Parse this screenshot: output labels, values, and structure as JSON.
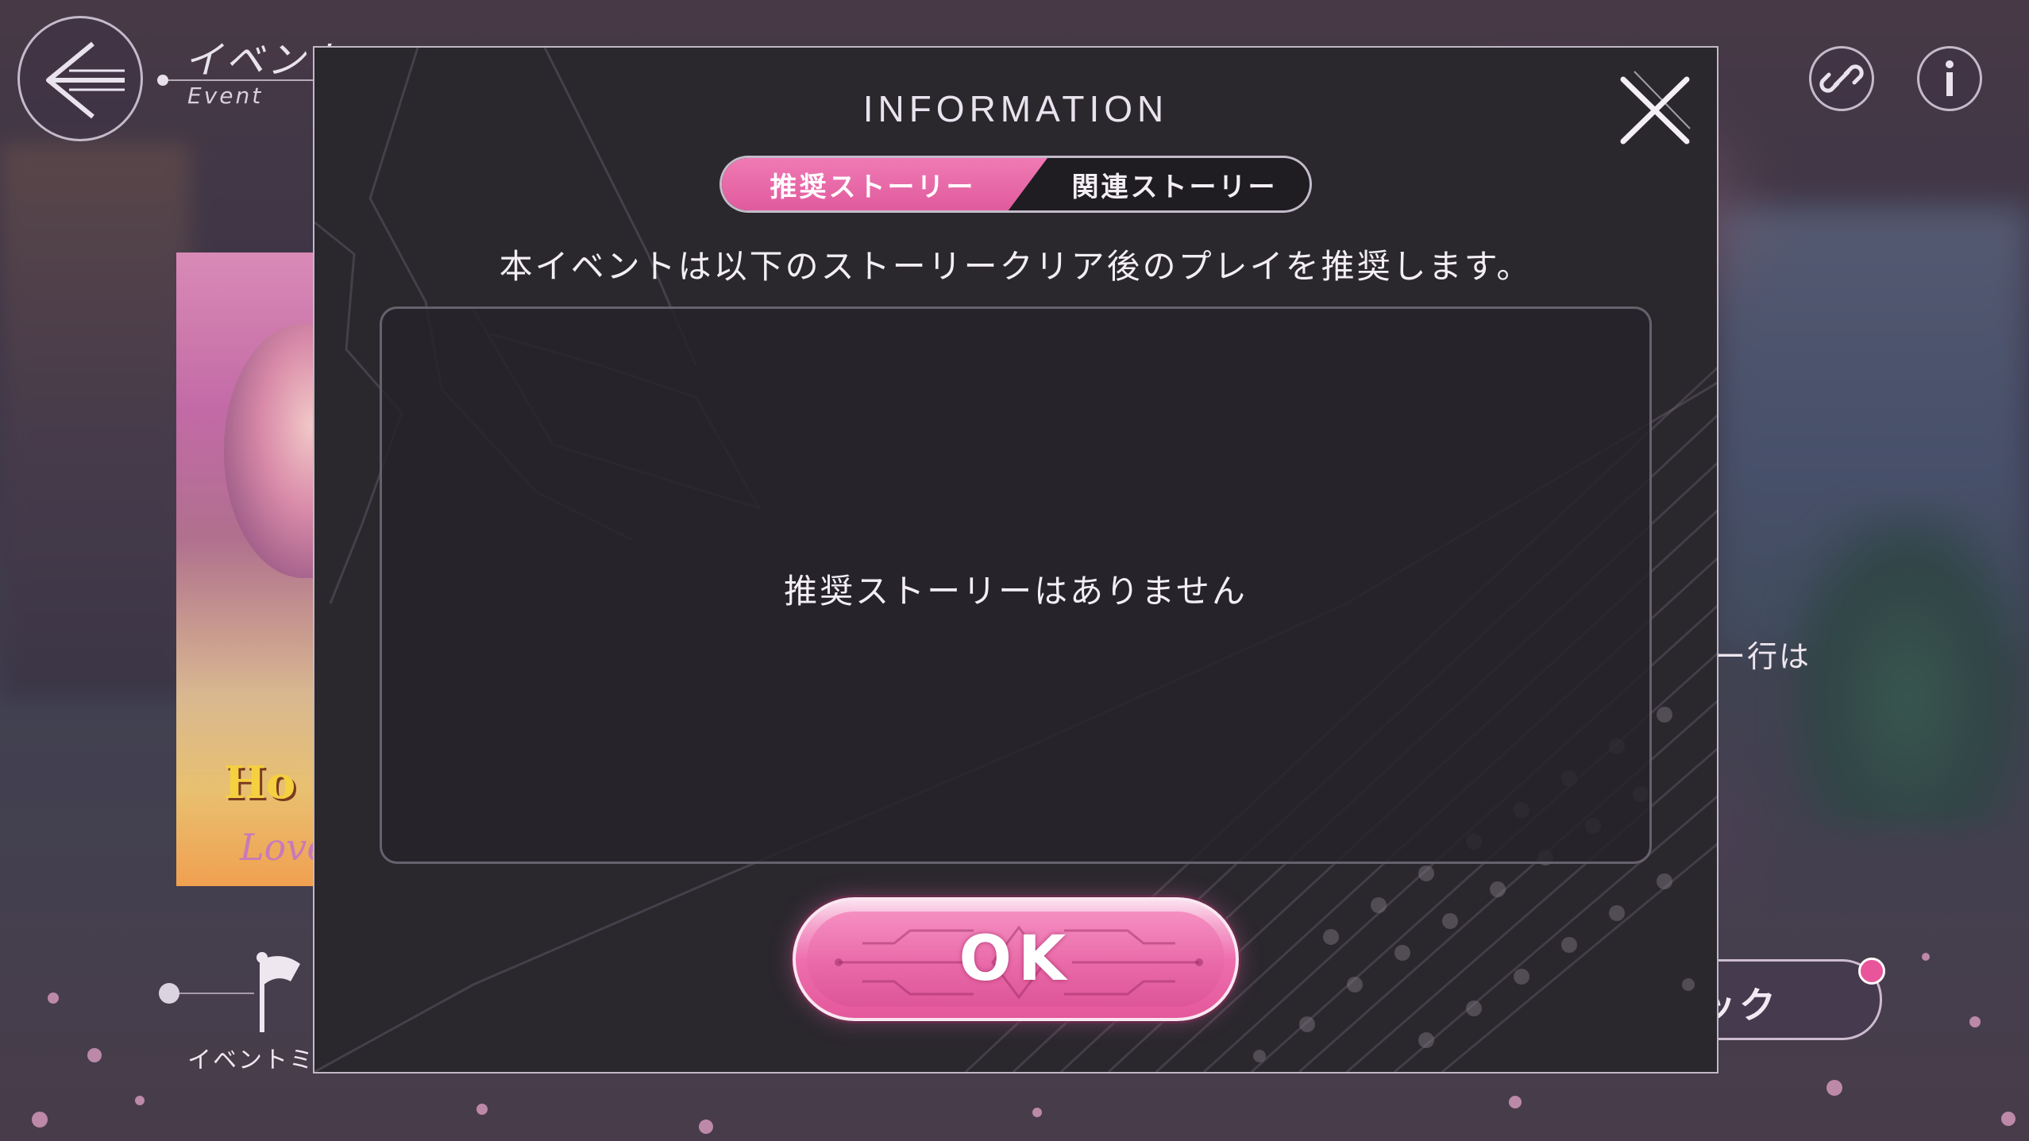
{
  "header": {
    "title": "イベント",
    "subtitle": "Event"
  },
  "background": {
    "mission_label": "イベントミ",
    "banner_logo_line1": "Ho",
    "banner_logo_line2": "Love",
    "right_text_fragment": "ー行は",
    "right_button_fragment": "ック"
  },
  "icons": {
    "back": "back-arrow-icon",
    "link": "link-icon",
    "info": "info-icon",
    "close": "close-icon",
    "flag": "flag-icon"
  },
  "modal": {
    "title": "INFORMATION",
    "tabs": [
      {
        "label": "推奨ストーリー",
        "active": true
      },
      {
        "label": "関連ストーリー",
        "active": false
      }
    ],
    "recommend_message": "本イベントは以下のストーリークリア後のプレイを推奨します。",
    "empty_message": "推奨ストーリーはありません",
    "ok_label": "OK"
  },
  "colors": {
    "accent_pink": "#e8559a",
    "modal_bg": "#2a272d",
    "text_light": "#f2eef4"
  }
}
